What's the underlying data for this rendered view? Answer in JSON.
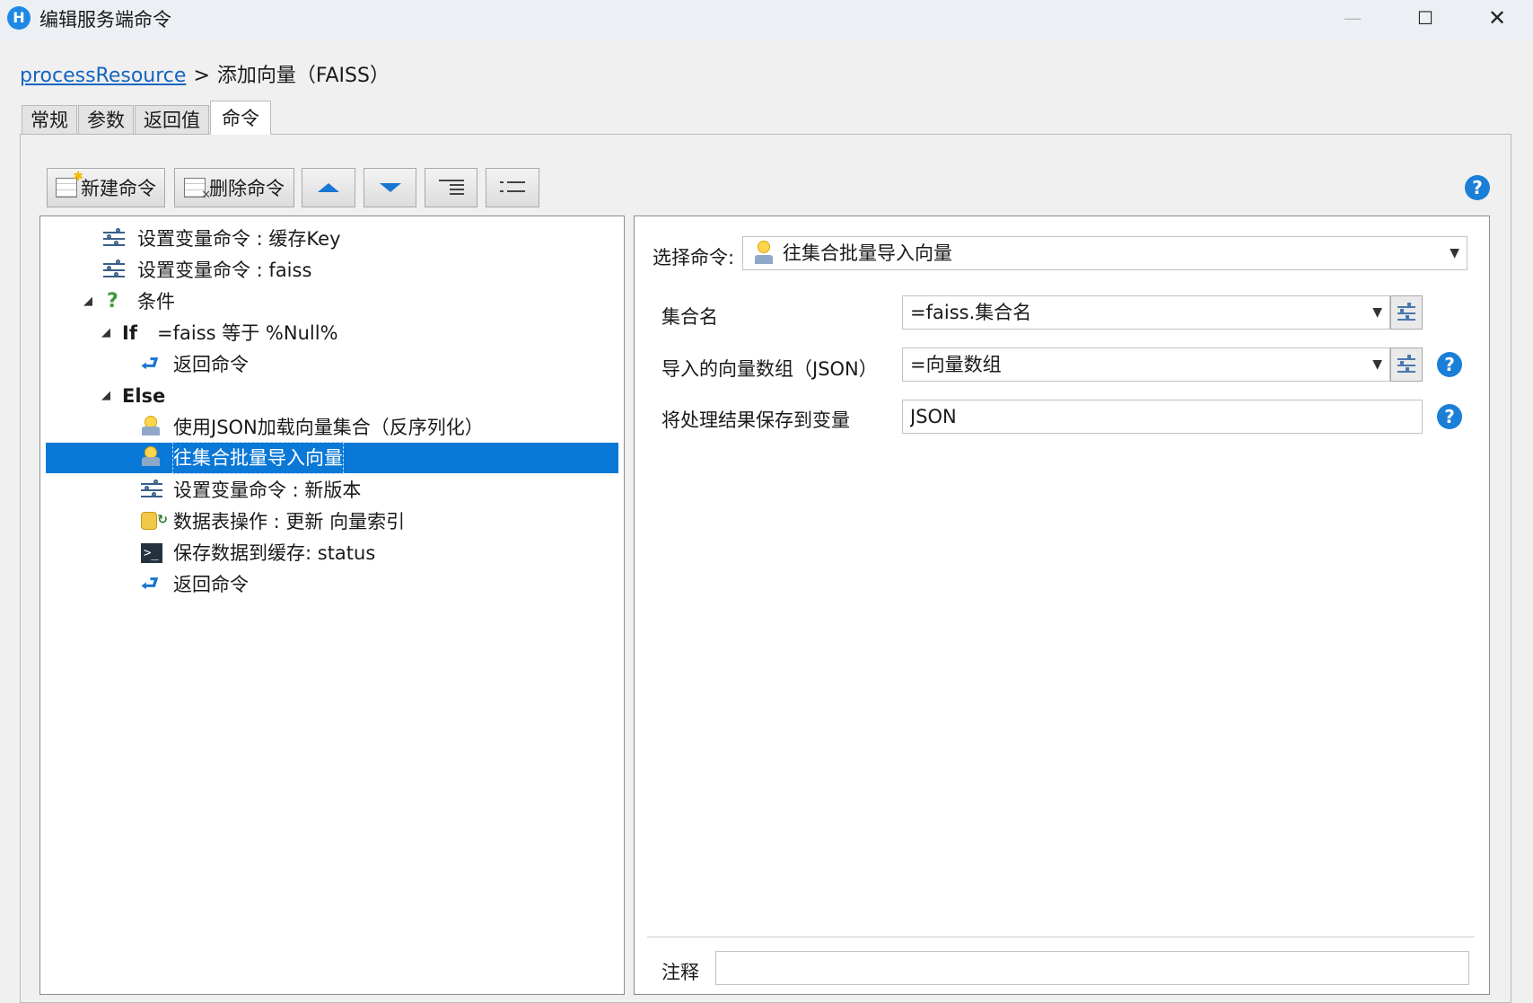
{
  "window": {
    "title": "编辑服务端命令",
    "app_icon": "H",
    "minimize": "—",
    "maximize": "☐",
    "close": "✕"
  },
  "breadcrumb": {
    "link": "processResource",
    "separator": ">",
    "current": "添加向量（FAISS）"
  },
  "tabs": [
    {
      "label": "常规"
    },
    {
      "label": "参数"
    },
    {
      "label": "返回值"
    },
    {
      "label": "命令"
    }
  ],
  "toolbar": {
    "new_label": "新建命令",
    "delete_label": "删除命令",
    "help": "?"
  },
  "tree": {
    "expander": "◢",
    "items": [
      {
        "label": "设置变量命令 : 缓存Key",
        "icon": "sliders-icon"
      },
      {
        "label": "设置变量命令 : faiss",
        "icon": "sliders-icon"
      },
      {
        "label": "条件",
        "icon": "question-icon",
        "glyph": "?"
      },
      {
        "label": "If",
        "cond": "=faiss 等于 %Null%"
      },
      {
        "label": "返回命令",
        "icon": "return-icon",
        "glyph": "⮐"
      },
      {
        "label": "Else"
      },
      {
        "label": "使用JSON加载向量集合（反序列化）",
        "icon": "bulb-icon"
      },
      {
        "label": "往集合批量导入向量",
        "icon": "bulb-icon",
        "selected": true
      },
      {
        "label": "设置变量命令 : 新版本",
        "icon": "sliders-icon"
      },
      {
        "label": "数据表操作 : 更新 向量索引",
        "icon": "database-icon",
        "glyph": "↻"
      },
      {
        "label": "保存数据到缓存: status",
        "icon": "terminal-icon",
        "glyph": ">_"
      },
      {
        "label": "返回命令",
        "icon": "return-icon",
        "glyph": "⮐"
      }
    ]
  },
  "editor": {
    "select_label": "选择命令:",
    "select_value": "往集合批量导入向量",
    "arrow": "▼",
    "fields": [
      {
        "label": "集合名",
        "value": "=faiss.集合名"
      },
      {
        "label": "导入的向量数组（JSON）",
        "value": "=向量数组"
      },
      {
        "label": "将处理结果保存到变量",
        "value": "JSON"
      }
    ],
    "comment_label": "注释",
    "comment_value": "",
    "help": "?"
  }
}
